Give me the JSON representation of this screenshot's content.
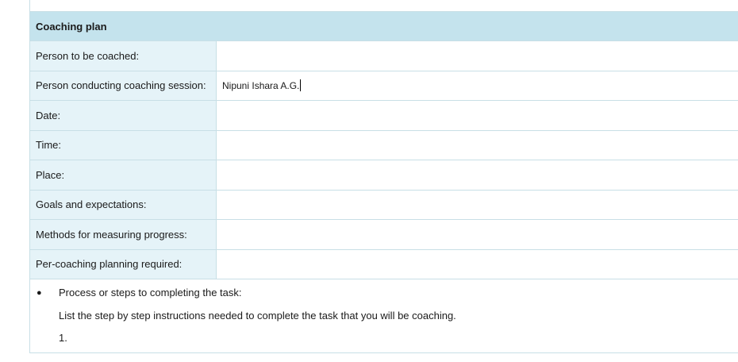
{
  "plan": {
    "title": "Coaching plan",
    "rows": [
      {
        "label": "Person to be coached:",
        "value": ""
      },
      {
        "label": "Person conducting coaching session:",
        "value": "Nipuni Ishara A.G."
      },
      {
        "label": "Date:",
        "value": ""
      },
      {
        "label": "Time:",
        "value": ""
      },
      {
        "label": "Place:",
        "value": ""
      },
      {
        "label": "Goals and expectations:",
        "value": ""
      },
      {
        "label": "Methods for measuring progress:",
        "value": ""
      },
      {
        "label": "Per-coaching planning required:",
        "value": ""
      }
    ]
  },
  "notes": {
    "bullet_symbol": "●",
    "bullet_text": "Process or steps to completing the task:",
    "instruction": "List the step by step instructions needed to complete the task that you will be coaching.",
    "first_step": "1."
  }
}
